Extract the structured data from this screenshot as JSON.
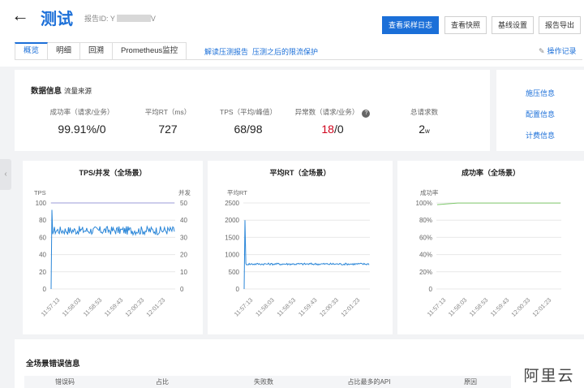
{
  "header": {
    "title": "测试",
    "report_id_label": "报告ID: Y",
    "report_id_tail": "V",
    "buttons": {
      "sampling_log": "查看采样日志",
      "snapshot": "查看快照",
      "baseline": "基线设置",
      "export": "报告导出"
    }
  },
  "tabs": [
    "概览",
    "明细",
    "回溯",
    "Prometheus监控"
  ],
  "links": {
    "interpret": "解读压测报告",
    "protection": "压测之后的限流保护",
    "oplog": "操作记录"
  },
  "data_info": {
    "title": "数据信息",
    "subtitle": "流量来源",
    "metrics": [
      {
        "label": "成功率（请求/业务）",
        "value": "99.91%/0"
      },
      {
        "label": "平均RT（ms）",
        "value": "727"
      },
      {
        "label": "TPS（平均/峰值）",
        "value": "68/98"
      },
      {
        "label": "异常数（请求/业务）",
        "value_red": "18",
        "value_rest": "/0"
      },
      {
        "label": "总请求数",
        "value": "2",
        "value_unit": "w"
      }
    ]
  },
  "side_links": [
    "施压信息",
    "配置信息",
    "计费信息"
  ],
  "errors": {
    "title": "全场景错误信息",
    "columns": [
      "错误码",
      "占比",
      "失败数",
      "占比最多的API",
      "原因"
    ]
  },
  "watermark": "阿里云",
  "colors": {
    "accent": "#1b6fd8",
    "series_blue": "#2a86d8",
    "series_purple": "#9b9bd8",
    "series_green": "#7dc86a",
    "error_red": "#d0021b"
  },
  "chart_data": [
    {
      "type": "line",
      "title": "TPS/并发（全场景）",
      "left_axis_label": "TPS",
      "right_axis_label": "并发",
      "x_tick_labels": [
        "11:57:13",
        "11:58:03",
        "11:58:53",
        "11:59:43",
        "12:00:33",
        "12:01:23"
      ],
      "y_ticks_left": [
        0,
        20,
        40,
        60,
        80,
        100
      ],
      "y_ticks_right": [
        0,
        10,
        20,
        30,
        40,
        50
      ],
      "ylim_left": [
        0,
        100
      ],
      "ylim_right": [
        0,
        50
      ],
      "series": [
        {
          "name": "TPS",
          "axis": "left",
          "color": "#2a86d8",
          "baseline": 68,
          "noise": 5,
          "start_spike": 92
        },
        {
          "name": "并发",
          "axis": "right",
          "color": "#9b9bd8",
          "values": [
            50,
            50
          ]
        }
      ]
    },
    {
      "type": "line",
      "title": "平均RT（全场景）",
      "left_axis_label": "平均RT",
      "x_tick_labels": [
        "11:57:13",
        "11:58:03",
        "11:58:53",
        "11:59:43",
        "12:00:33",
        "12:01:23"
      ],
      "y_ticks_left": [
        0,
        500,
        1000,
        1500,
        2000,
        2500
      ],
      "ylim_left": [
        0,
        2500
      ],
      "series": [
        {
          "name": "平均RT",
          "axis": "left",
          "color": "#2a86d8",
          "baseline": 725,
          "noise": 30,
          "start_spike": 2000
        }
      ]
    },
    {
      "type": "line",
      "title": "成功率（全场景）",
      "left_axis_label": "成功率",
      "x_tick_labels": [
        "11:57:13",
        "11:58:03",
        "11:58:53",
        "11:59:43",
        "12:00:33",
        "12:01:23"
      ],
      "y_ticks_left": [
        "0",
        "20%",
        "40%",
        "60%",
        "80%",
        "100%"
      ],
      "ylim_left": [
        0,
        100
      ],
      "series": [
        {
          "name": "成功率",
          "axis": "left",
          "color": "#7dc86a",
          "values": [
            98,
            99.9,
            99.9,
            99.9,
            99.9,
            99.9,
            99.9
          ]
        }
      ]
    }
  ]
}
